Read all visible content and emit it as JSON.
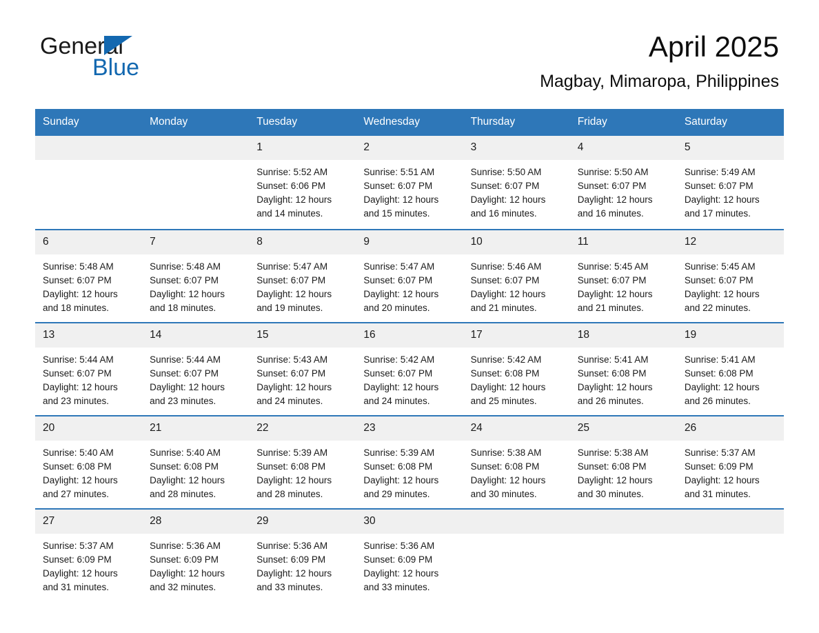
{
  "brand": {
    "name_part1": "General",
    "name_part2": "Blue",
    "triangle_icon": "triangle-icon",
    "accent_color": "#1368b0"
  },
  "header": {
    "month_year": "April 2025",
    "location": "Magbay, Mimaropa, Philippines"
  },
  "calendar": {
    "header_color": "#2e77b8",
    "date_band_color": "#f0f0f0",
    "weekdays": [
      "Sunday",
      "Monday",
      "Tuesday",
      "Wednesday",
      "Thursday",
      "Friday",
      "Saturday"
    ],
    "weeks": [
      [
        {
          "day": "",
          "sunrise": "",
          "sunset": "",
          "daylight": "",
          "empty": true
        },
        {
          "day": "",
          "sunrise": "",
          "sunset": "",
          "daylight": "",
          "empty": true
        },
        {
          "day": "1",
          "sunrise": "Sunrise: 5:52 AM",
          "sunset": "Sunset: 6:06 PM",
          "daylight": "Daylight: 12 hours and 14 minutes."
        },
        {
          "day": "2",
          "sunrise": "Sunrise: 5:51 AM",
          "sunset": "Sunset: 6:07 PM",
          "daylight": "Daylight: 12 hours and 15 minutes."
        },
        {
          "day": "3",
          "sunrise": "Sunrise: 5:50 AM",
          "sunset": "Sunset: 6:07 PM",
          "daylight": "Daylight: 12 hours and 16 minutes."
        },
        {
          "day": "4",
          "sunrise": "Sunrise: 5:50 AM",
          "sunset": "Sunset: 6:07 PM",
          "daylight": "Daylight: 12 hours and 16 minutes."
        },
        {
          "day": "5",
          "sunrise": "Sunrise: 5:49 AM",
          "sunset": "Sunset: 6:07 PM",
          "daylight": "Daylight: 12 hours and 17 minutes."
        }
      ],
      [
        {
          "day": "6",
          "sunrise": "Sunrise: 5:48 AM",
          "sunset": "Sunset: 6:07 PM",
          "daylight": "Daylight: 12 hours and 18 minutes."
        },
        {
          "day": "7",
          "sunrise": "Sunrise: 5:48 AM",
          "sunset": "Sunset: 6:07 PM",
          "daylight": "Daylight: 12 hours and 18 minutes."
        },
        {
          "day": "8",
          "sunrise": "Sunrise: 5:47 AM",
          "sunset": "Sunset: 6:07 PM",
          "daylight": "Daylight: 12 hours and 19 minutes."
        },
        {
          "day": "9",
          "sunrise": "Sunrise: 5:47 AM",
          "sunset": "Sunset: 6:07 PM",
          "daylight": "Daylight: 12 hours and 20 minutes."
        },
        {
          "day": "10",
          "sunrise": "Sunrise: 5:46 AM",
          "sunset": "Sunset: 6:07 PM",
          "daylight": "Daylight: 12 hours and 21 minutes."
        },
        {
          "day": "11",
          "sunrise": "Sunrise: 5:45 AM",
          "sunset": "Sunset: 6:07 PM",
          "daylight": "Daylight: 12 hours and 21 minutes."
        },
        {
          "day": "12",
          "sunrise": "Sunrise: 5:45 AM",
          "sunset": "Sunset: 6:07 PM",
          "daylight": "Daylight: 12 hours and 22 minutes."
        }
      ],
      [
        {
          "day": "13",
          "sunrise": "Sunrise: 5:44 AM",
          "sunset": "Sunset: 6:07 PM",
          "daylight": "Daylight: 12 hours and 23 minutes."
        },
        {
          "day": "14",
          "sunrise": "Sunrise: 5:44 AM",
          "sunset": "Sunset: 6:07 PM",
          "daylight": "Daylight: 12 hours and 23 minutes."
        },
        {
          "day": "15",
          "sunrise": "Sunrise: 5:43 AM",
          "sunset": "Sunset: 6:07 PM",
          "daylight": "Daylight: 12 hours and 24 minutes."
        },
        {
          "day": "16",
          "sunrise": "Sunrise: 5:42 AM",
          "sunset": "Sunset: 6:07 PM",
          "daylight": "Daylight: 12 hours and 24 minutes."
        },
        {
          "day": "17",
          "sunrise": "Sunrise: 5:42 AM",
          "sunset": "Sunset: 6:08 PM",
          "daylight": "Daylight: 12 hours and 25 minutes."
        },
        {
          "day": "18",
          "sunrise": "Sunrise: 5:41 AM",
          "sunset": "Sunset: 6:08 PM",
          "daylight": "Daylight: 12 hours and 26 minutes."
        },
        {
          "day": "19",
          "sunrise": "Sunrise: 5:41 AM",
          "sunset": "Sunset: 6:08 PM",
          "daylight": "Daylight: 12 hours and 26 minutes."
        }
      ],
      [
        {
          "day": "20",
          "sunrise": "Sunrise: 5:40 AM",
          "sunset": "Sunset: 6:08 PM",
          "daylight": "Daylight: 12 hours and 27 minutes."
        },
        {
          "day": "21",
          "sunrise": "Sunrise: 5:40 AM",
          "sunset": "Sunset: 6:08 PM",
          "daylight": "Daylight: 12 hours and 28 minutes."
        },
        {
          "day": "22",
          "sunrise": "Sunrise: 5:39 AM",
          "sunset": "Sunset: 6:08 PM",
          "daylight": "Daylight: 12 hours and 28 minutes."
        },
        {
          "day": "23",
          "sunrise": "Sunrise: 5:39 AM",
          "sunset": "Sunset: 6:08 PM",
          "daylight": "Daylight: 12 hours and 29 minutes."
        },
        {
          "day": "24",
          "sunrise": "Sunrise: 5:38 AM",
          "sunset": "Sunset: 6:08 PM",
          "daylight": "Daylight: 12 hours and 30 minutes."
        },
        {
          "day": "25",
          "sunrise": "Sunrise: 5:38 AM",
          "sunset": "Sunset: 6:08 PM",
          "daylight": "Daylight: 12 hours and 30 minutes."
        },
        {
          "day": "26",
          "sunrise": "Sunrise: 5:37 AM",
          "sunset": "Sunset: 6:09 PM",
          "daylight": "Daylight: 12 hours and 31 minutes."
        }
      ],
      [
        {
          "day": "27",
          "sunrise": "Sunrise: 5:37 AM",
          "sunset": "Sunset: 6:09 PM",
          "daylight": "Daylight: 12 hours and 31 minutes."
        },
        {
          "day": "28",
          "sunrise": "Sunrise: 5:36 AM",
          "sunset": "Sunset: 6:09 PM",
          "daylight": "Daylight: 12 hours and 32 minutes."
        },
        {
          "day": "29",
          "sunrise": "Sunrise: 5:36 AM",
          "sunset": "Sunset: 6:09 PM",
          "daylight": "Daylight: 12 hours and 33 minutes."
        },
        {
          "day": "30",
          "sunrise": "Sunrise: 5:36 AM",
          "sunset": "Sunset: 6:09 PM",
          "daylight": "Daylight: 12 hours and 33 minutes."
        },
        {
          "day": "",
          "sunrise": "",
          "sunset": "",
          "daylight": "",
          "empty": true
        },
        {
          "day": "",
          "sunrise": "",
          "sunset": "",
          "daylight": "",
          "empty": true
        },
        {
          "day": "",
          "sunrise": "",
          "sunset": "",
          "daylight": "",
          "empty": true
        }
      ]
    ]
  }
}
